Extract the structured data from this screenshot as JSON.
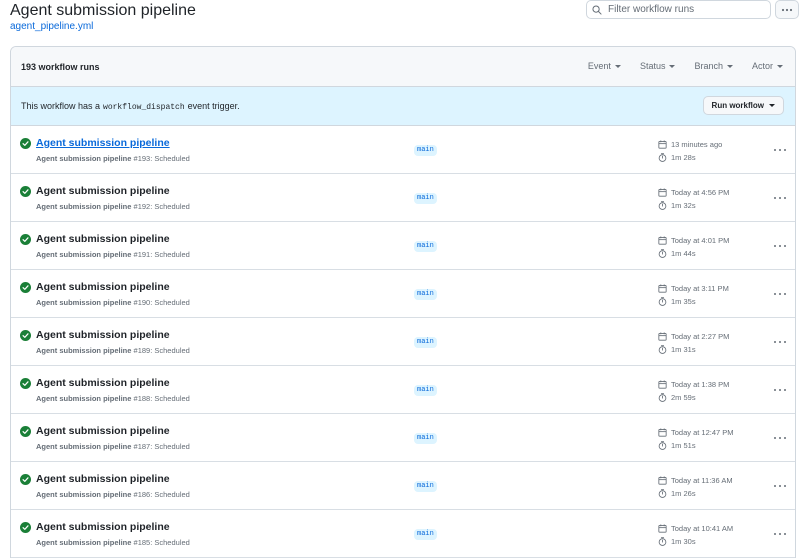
{
  "header": {
    "title": "Agent submission pipeline",
    "subtitle": "agent_pipeline.yml",
    "filter_placeholder": "Filter workflow runs"
  },
  "runs_header": {
    "count": "193 workflow runs",
    "filters": [
      "Event",
      "Status",
      "Branch",
      "Actor"
    ]
  },
  "dispatch": {
    "prefix": "This workflow has a",
    "code": "workflow_dispatch",
    "suffix": "event trigger.",
    "button": "Run workflow"
  },
  "colors": {
    "success": "#1a7f37",
    "link": "#0969da",
    "banner": "#ddf4ff"
  },
  "icons": {
    "status": "check-circle-fill-icon",
    "date": "calendar-icon",
    "duration": "stopwatch-icon",
    "more": "kebab-horizontal-icon"
  },
  "runs": [
    {
      "title": "Agent submission pipeline",
      "workflow": "Agent submission pipeline",
      "number": "#193",
      "trigger": ": Scheduled",
      "branch": "main",
      "when": "13 minutes ago",
      "duration": "1m 28s"
    },
    {
      "title": "Agent submission pipeline",
      "workflow": "Agent submission pipeline",
      "number": "#192",
      "trigger": ": Scheduled",
      "branch": "main",
      "when": "Today at 4:56 PM",
      "duration": "1m 32s"
    },
    {
      "title": "Agent submission pipeline",
      "workflow": "Agent submission pipeline",
      "number": "#191",
      "trigger": ": Scheduled",
      "branch": "main",
      "when": "Today at 4:01 PM",
      "duration": "1m 44s"
    },
    {
      "title": "Agent submission pipeline",
      "workflow": "Agent submission pipeline",
      "number": "#190",
      "trigger": ": Scheduled",
      "branch": "main",
      "when": "Today at 3:11 PM",
      "duration": "1m 35s"
    },
    {
      "title": "Agent submission pipeline",
      "workflow": "Agent submission pipeline",
      "number": "#189",
      "trigger": ": Scheduled",
      "branch": "main",
      "when": "Today at 2:27 PM",
      "duration": "1m 31s"
    },
    {
      "title": "Agent submission pipeline",
      "workflow": "Agent submission pipeline",
      "number": "#188",
      "trigger": ": Scheduled",
      "branch": "main",
      "when": "Today at 1:38 PM",
      "duration": "2m 59s"
    },
    {
      "title": "Agent submission pipeline",
      "workflow": "Agent submission pipeline",
      "number": "#187",
      "trigger": ": Scheduled",
      "branch": "main",
      "when": "Today at 12:47 PM",
      "duration": "1m 51s"
    },
    {
      "title": "Agent submission pipeline",
      "workflow": "Agent submission pipeline",
      "number": "#186",
      "trigger": ": Scheduled",
      "branch": "main",
      "when": "Today at 11:36 AM",
      "duration": "1m 26s"
    },
    {
      "title": "Agent submission pipeline",
      "workflow": "Agent submission pipeline",
      "number": "#185",
      "trigger": ": Scheduled",
      "branch": "main",
      "when": "Today at 10:41 AM",
      "duration": "1m 30s"
    }
  ]
}
